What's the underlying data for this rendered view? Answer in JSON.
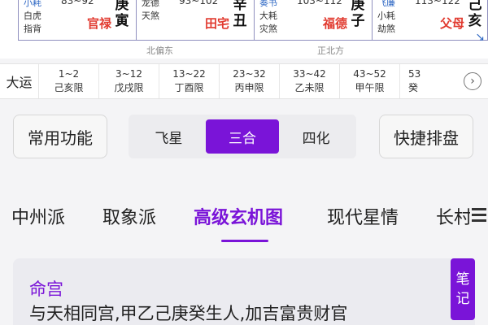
{
  "chart": {
    "palaces": [
      {
        "stars": [
          "小耗",
          "白虎",
          "指背"
        ],
        "age": "83~92",
        "palace": "官禄",
        "branch": [
          "庚",
          "寅"
        ]
      },
      {
        "stars": [
          "",
          "龙德",
          "天煞"
        ],
        "age": "93~102",
        "palace": "田宅",
        "branch": [
          "辛",
          "丑"
        ]
      },
      {
        "stars": [
          "奏书",
          "大耗",
          "灾煞"
        ],
        "age": "103~112",
        "palace": "福德",
        "branch": [
          "庚",
          "子"
        ]
      },
      {
        "stars": [
          "飞廉",
          "小耗",
          "劫煞"
        ],
        "age": "113~122",
        "palace": "父母",
        "branch": [
          "己",
          "亥"
        ]
      }
    ],
    "directions": [
      "北偏东",
      "正北方"
    ]
  },
  "dayun": {
    "label": "大运",
    "items": [
      {
        "range": "1~2",
        "name": "己亥限"
      },
      {
        "range": "3~12",
        "name": "戊戌限"
      },
      {
        "range": "13~22",
        "name": "丁酉限"
      },
      {
        "range": "23~32",
        "name": "丙申限"
      },
      {
        "range": "33~42",
        "name": "乙未限"
      },
      {
        "range": "43~52",
        "name": "甲午限"
      },
      {
        "range": "53",
        "name": "癸"
      }
    ]
  },
  "controls": {
    "common": "常用功能",
    "modes": [
      "飞星",
      "三合",
      "四化"
    ],
    "active_mode": "三合",
    "quick": "快捷排盘"
  },
  "tabs": [
    "中州派",
    "取象派",
    "高级玄机图",
    "现代星情",
    "长村"
  ],
  "active_tab": "高级玄机图",
  "card": {
    "title": "命宫",
    "text": "与天相同宫,甲乙己庚癸生人,加吉富贵财官",
    "note_button": [
      "笔",
      "记"
    ]
  },
  "colors": {
    "accent": "#7a14d8",
    "palace_red": "#e13a2f",
    "star_blue": "#2f68c4"
  }
}
